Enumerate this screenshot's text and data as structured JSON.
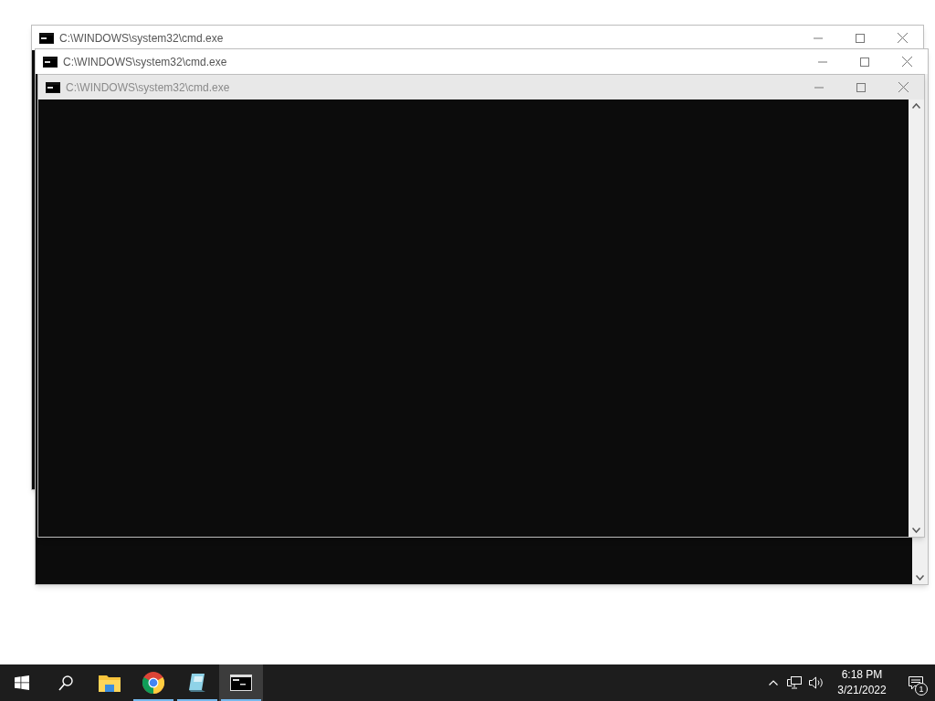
{
  "windows": [
    {
      "title": "C:\\WINDOWS\\system32\\cmd.exe",
      "focused": false
    },
    {
      "title": "C:\\WINDOWS\\system32\\cmd.exe",
      "focused": false
    },
    {
      "title": "C:\\WINDOWS\\system32\\cmd.exe",
      "focused": true
    }
  ],
  "taskbar": {
    "apps": [
      {
        "kind": "explorer",
        "running": false,
        "selected": false
      },
      {
        "kind": "chrome",
        "running": true,
        "selected": false
      },
      {
        "kind": "notepad",
        "running": true,
        "selected": false
      },
      {
        "kind": "terminal",
        "running": true,
        "selected": true
      }
    ],
    "clock": {
      "time": "6:18 PM",
      "date": "3/21/2022"
    },
    "notification_count": "1"
  }
}
